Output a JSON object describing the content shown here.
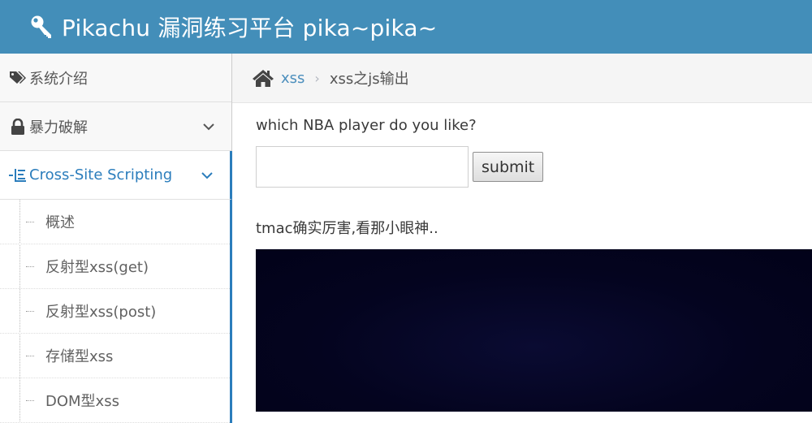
{
  "header": {
    "title": "Pikachu 漏洞练习平台 pika~pika~"
  },
  "sidebar": {
    "items": [
      {
        "label": "系统介绍",
        "icon": "tags-icon"
      },
      {
        "label": "暴力破解",
        "icon": "lock-icon"
      },
      {
        "label": "Cross-Site Scripting",
        "icon": "list-tree-icon"
      }
    ],
    "submenu": [
      {
        "label": "概述"
      },
      {
        "label": "反射型xss(get)"
      },
      {
        "label": "反射型xss(post)"
      },
      {
        "label": "存储型xss"
      },
      {
        "label": "DOM型xss"
      }
    ]
  },
  "breadcrumb": {
    "parent": "xss",
    "current": "xss之js输出"
  },
  "main": {
    "question": "which NBA player do you like?",
    "input_value": "",
    "submit_label": "submit",
    "result_text": "tmac确实厉害,看那小眼神.."
  },
  "colors": {
    "header_bg": "#438eb9",
    "active": "#2b7dbc",
    "link": "#4c8fbd"
  }
}
